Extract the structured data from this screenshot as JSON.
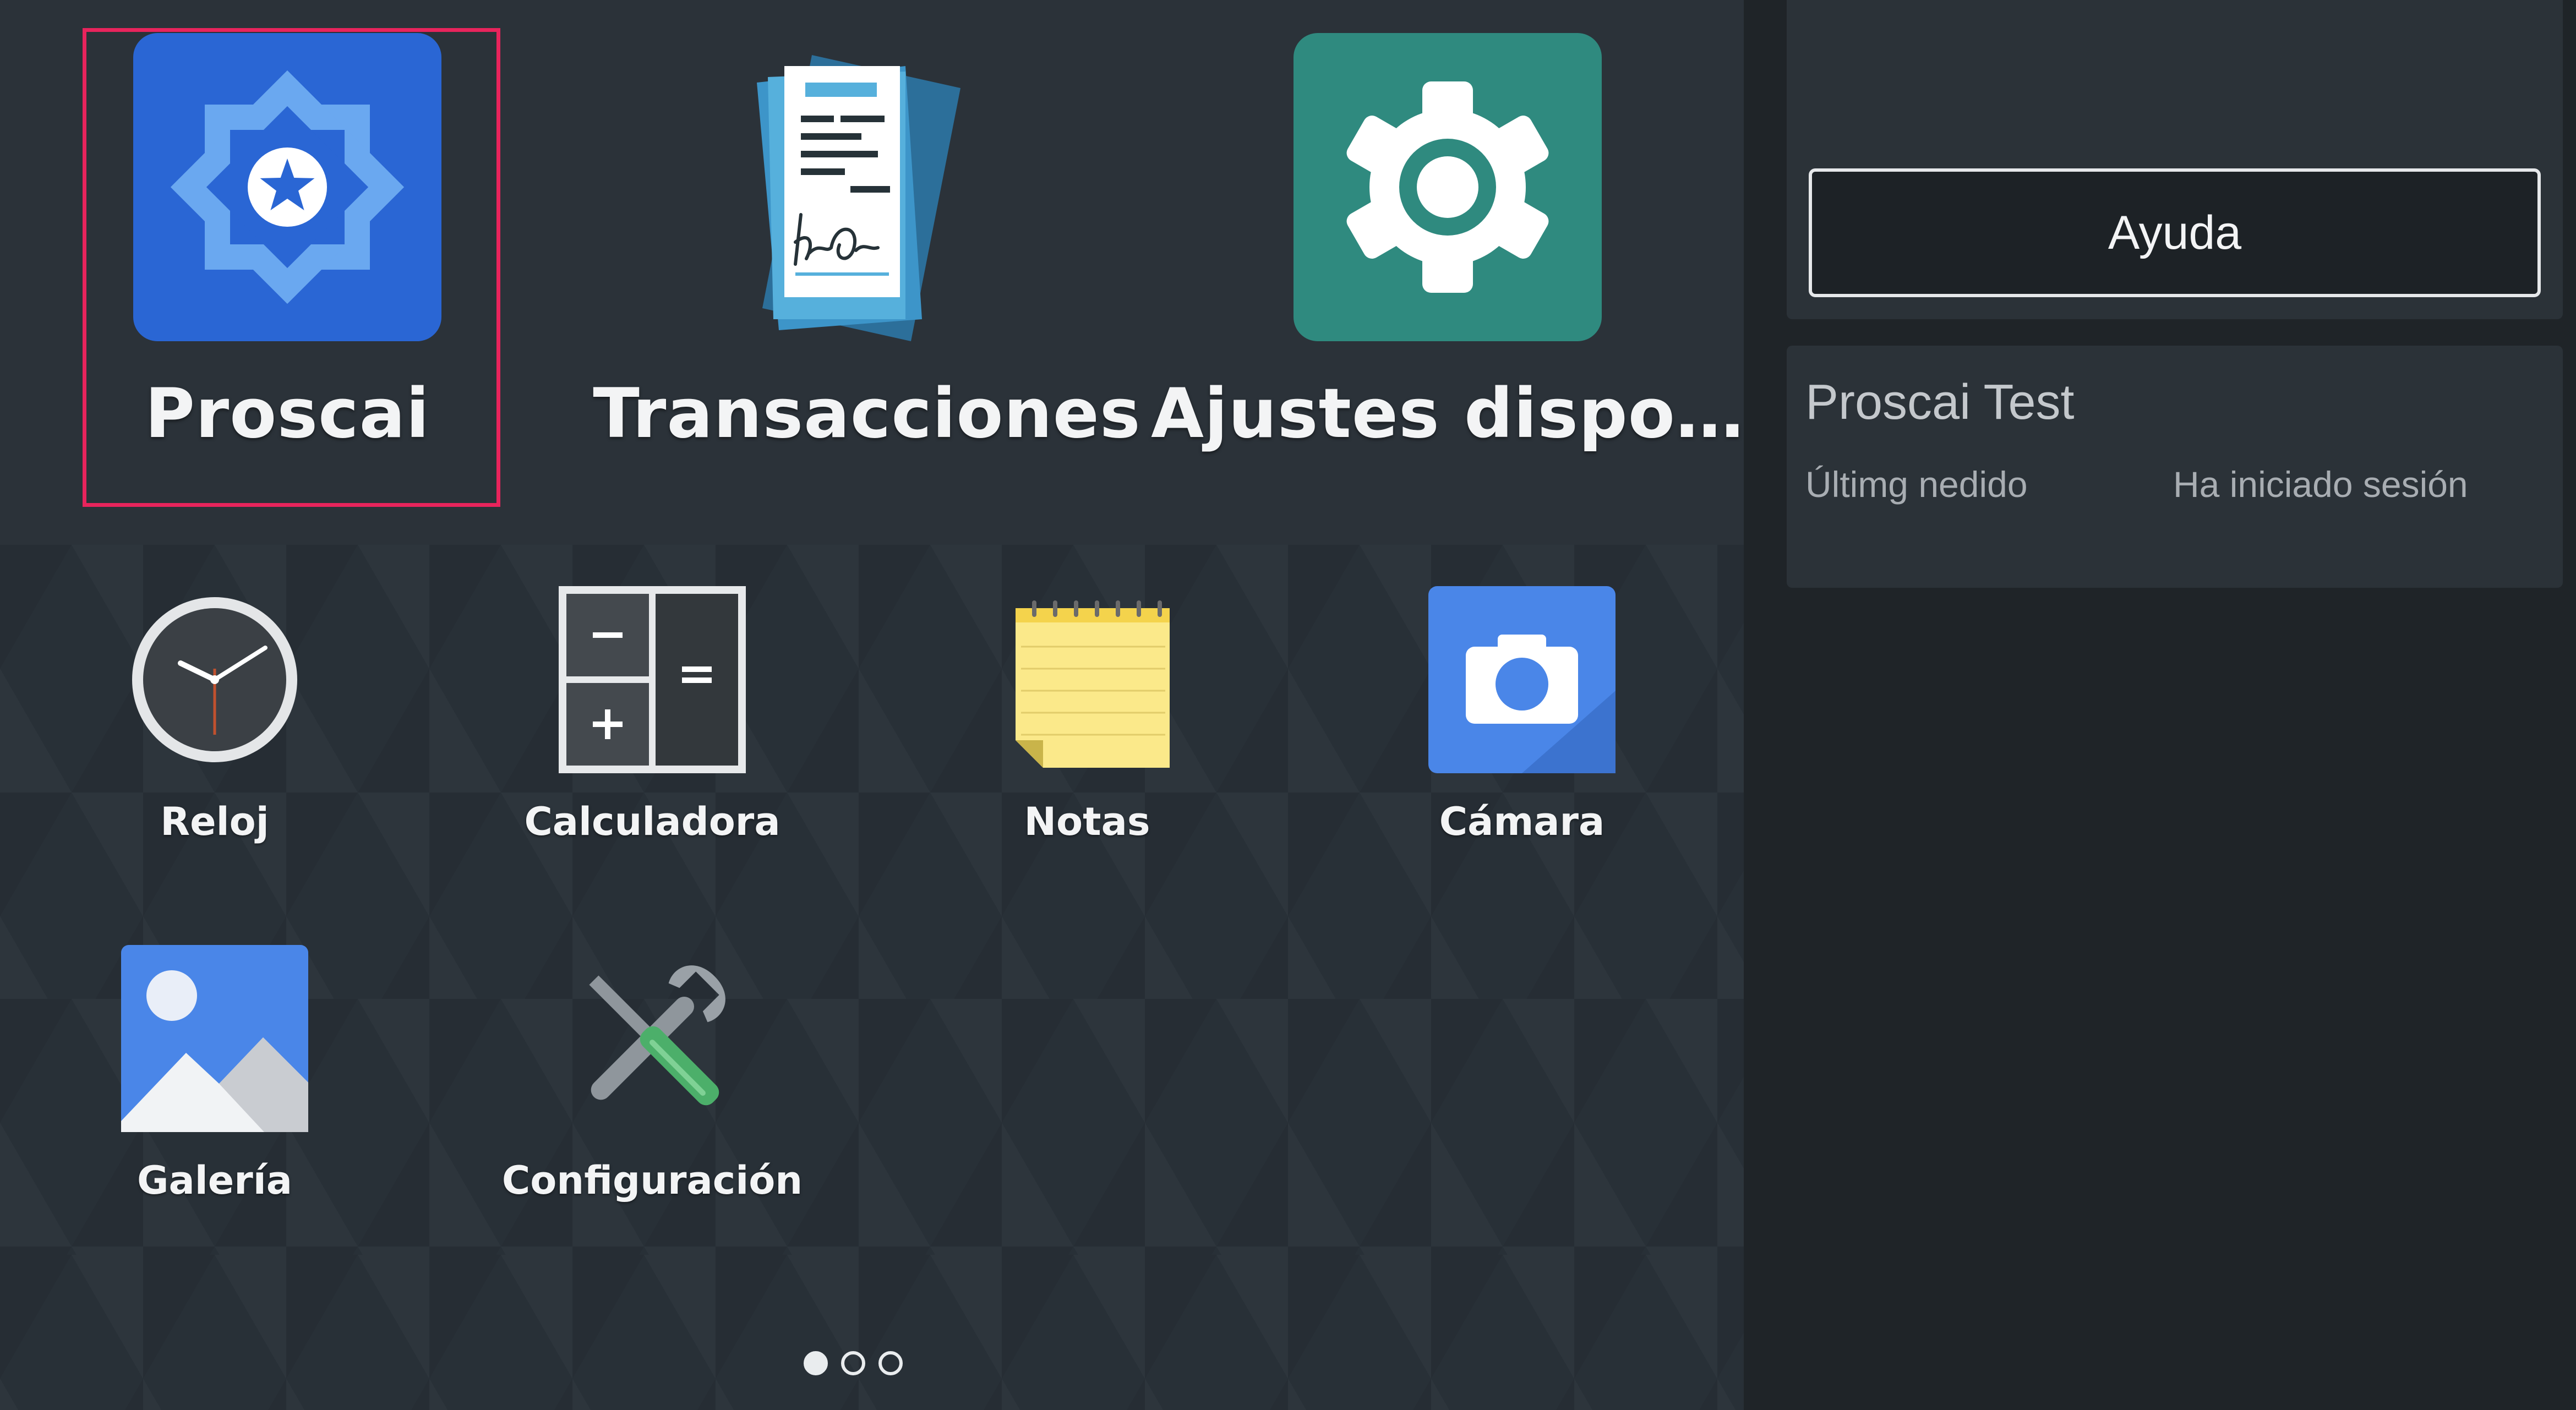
{
  "launcher": {
    "featured_apps": [
      {
        "label": "Proscai",
        "icon": "proscai-star-icon",
        "color": "#2a66d4",
        "selected": true
      },
      {
        "label": "Transacciones",
        "icon": "signed-documents-icon"
      },
      {
        "label": "Ajustes dispo…",
        "icon": "gear-icon",
        "color": "#2f8a7f"
      }
    ],
    "apps": [
      {
        "label": "Reloj",
        "icon": "clock-icon"
      },
      {
        "label": "Calculadora",
        "icon": "calculator-icon"
      },
      {
        "label": "Notas",
        "icon": "notepad-icon"
      },
      {
        "label": "Cámara",
        "icon": "camera-icon",
        "color": "#4a86e8"
      },
      {
        "label": "Galería",
        "icon": "gallery-icon"
      },
      {
        "label": "Configuración",
        "icon": "wrench-screwdriver-icon"
      }
    ],
    "page_indicator": {
      "pages": 3,
      "current": 1
    },
    "highlight_color": "#e8245c"
  },
  "panel": {
    "help_button_label": "Ayuda",
    "account_name": "Proscai Test",
    "last_order_label": "Últimg nedido",
    "session_status": "Ha iniciado sesión"
  }
}
